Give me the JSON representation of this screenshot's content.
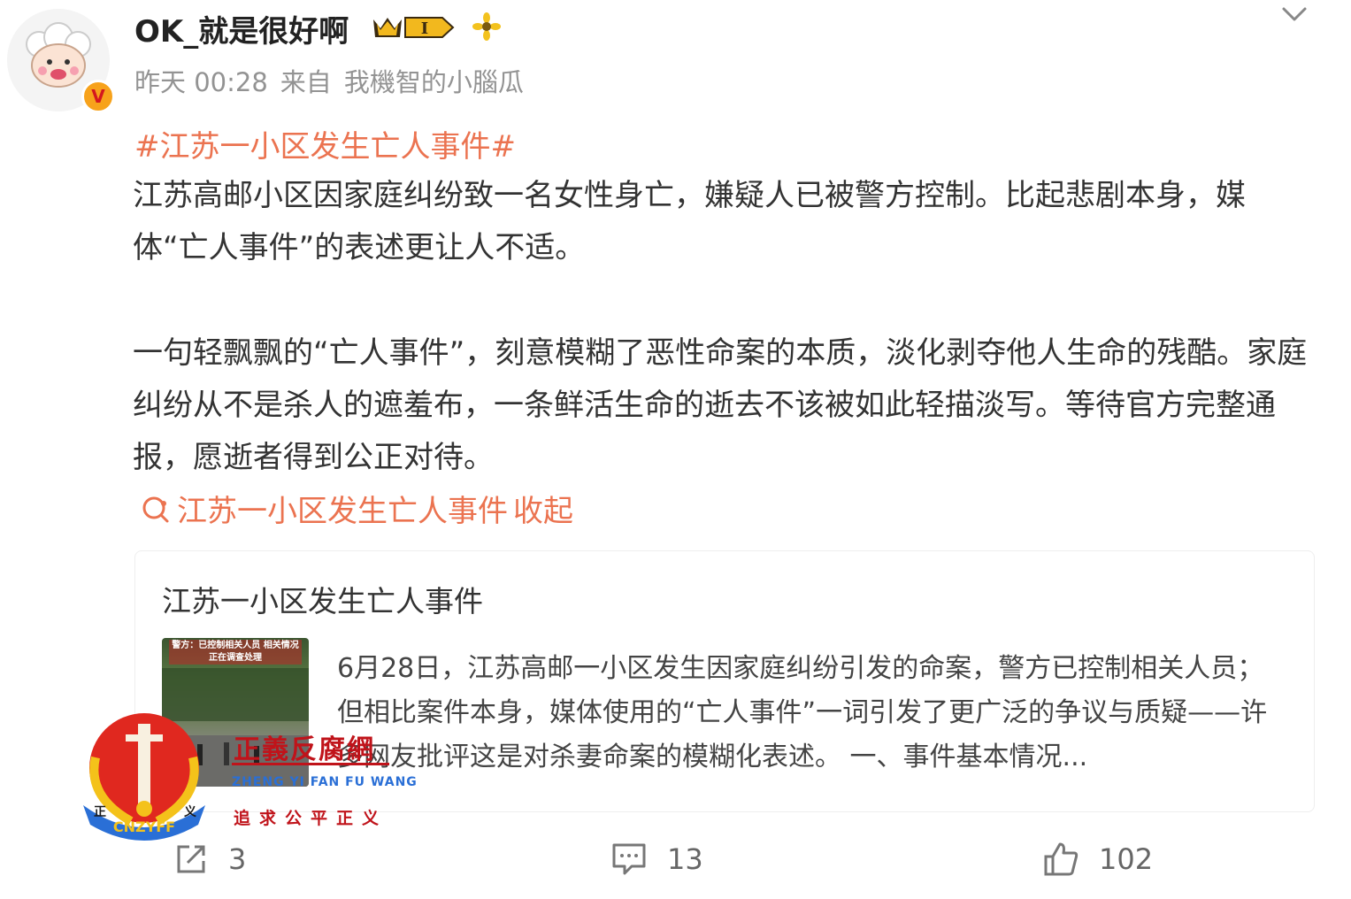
{
  "post": {
    "username": "OK_就是很好啊",
    "level_badge": "I",
    "verified_badge": "V",
    "time": "昨天 00:28",
    "source_prefix": "来自",
    "source": "我機智的小腦瓜",
    "hashtag": "#江苏一小区发生亡人事件#",
    "paragraph1": "江苏高邮小区因家庭纠纷致一名女性身亡，嫌疑人已被警方控制。比起悲剧本身，媒体“亡人事件”的表述更让人不适。",
    "paragraph2": "一句轻飘飘的“亡人事件”，刻意模糊了恶性命案的本质，淡化剥夺他人生命的残酷。家庭纠纷从不是杀人的遮羞布，一条鲜活生命的逝去不该被如此轻描淡写。等待官方完整通报，愿逝者得到公正对待。",
    "topic_link": "江苏一小区发生亡人事件",
    "collapse_label": "收起"
  },
  "card": {
    "title": "江苏一小区发生亡人事件",
    "thumb_caption": "警方：已控制相关人员 相关情况正在调查处理",
    "description": "6月28日，江苏高邮一小区发生因家庭纠纷引发的命案，警方已控制相关人员；但相比案件本身，媒体使用的“亡人事件”一词引发了更广泛的争议与质疑——许多网友批评这是对杀妻命案的模糊化表述。 一、事件基本情况..."
  },
  "actions": {
    "share_count": "3",
    "comment_count": "13",
    "like_count": "102"
  },
  "watermark": {
    "name": "正義反腐網",
    "pinyin": "ZHENG YI FAN FU WANG",
    "slogan": "追求公平正义",
    "emblem_text": "CNZYFF",
    "emblem_left": "正",
    "emblem_right": "义"
  },
  "colors": {
    "accent": "#eb7350",
    "text": "#333333",
    "meta": "#939393",
    "watermark_red": "#c0131a",
    "watermark_blue": "#2a6fd6"
  },
  "icons": [
    "chevron-down-icon",
    "crown-level-icon",
    "flower-icon",
    "topic-search-icon",
    "share-icon",
    "comment-icon",
    "like-icon"
  ]
}
